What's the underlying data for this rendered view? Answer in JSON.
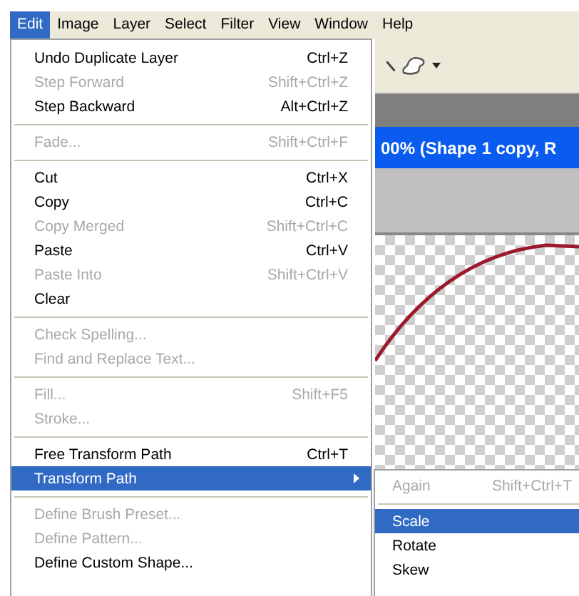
{
  "menu_bar": [
    {
      "label": "Edit",
      "selected": true
    },
    {
      "label": "Image",
      "selected": false
    },
    {
      "label": "Layer",
      "selected": false
    },
    {
      "label": "Select",
      "selected": false
    },
    {
      "label": "Filter",
      "selected": false
    },
    {
      "label": "View",
      "selected": false
    },
    {
      "label": "Window",
      "selected": false
    },
    {
      "label": "Help",
      "selected": false
    }
  ],
  "document": {
    "title": "00% (Shape 1 copy, R"
  },
  "edit_menu": [
    {
      "kind": "item",
      "label": "Undo Duplicate Layer",
      "shortcut": "Ctrl+Z",
      "disabled": false,
      "selected": false,
      "has_submenu": false
    },
    {
      "kind": "item",
      "label": "Step Forward",
      "shortcut": "Shift+Ctrl+Z",
      "disabled": true,
      "selected": false,
      "has_submenu": false
    },
    {
      "kind": "item",
      "label": "Step Backward",
      "shortcut": "Alt+Ctrl+Z",
      "disabled": false,
      "selected": false,
      "has_submenu": false
    },
    {
      "kind": "separator"
    },
    {
      "kind": "item",
      "label": "Fade...",
      "shortcut": "Shift+Ctrl+F",
      "disabled": true,
      "selected": false,
      "has_submenu": false
    },
    {
      "kind": "separator"
    },
    {
      "kind": "item",
      "label": "Cut",
      "shortcut": "Ctrl+X",
      "disabled": false,
      "selected": false,
      "has_submenu": false
    },
    {
      "kind": "item",
      "label": "Copy",
      "shortcut": "Ctrl+C",
      "disabled": false,
      "selected": false,
      "has_submenu": false
    },
    {
      "kind": "item",
      "label": "Copy Merged",
      "shortcut": "Shift+Ctrl+C",
      "disabled": true,
      "selected": false,
      "has_submenu": false
    },
    {
      "kind": "item",
      "label": "Paste",
      "shortcut": "Ctrl+V",
      "disabled": false,
      "selected": false,
      "has_submenu": false
    },
    {
      "kind": "item",
      "label": "Paste Into",
      "shortcut": "Shift+Ctrl+V",
      "disabled": true,
      "selected": false,
      "has_submenu": false
    },
    {
      "kind": "item",
      "label": "Clear",
      "disabled": false,
      "selected": false,
      "has_submenu": false
    },
    {
      "kind": "separator"
    },
    {
      "kind": "item",
      "label": "Check Spelling...",
      "disabled": true,
      "selected": false,
      "has_submenu": false
    },
    {
      "kind": "item",
      "label": "Find and Replace Text...",
      "disabled": true,
      "selected": false,
      "has_submenu": false
    },
    {
      "kind": "separator"
    },
    {
      "kind": "item",
      "label": "Fill...",
      "shortcut": "Shift+F5",
      "disabled": true,
      "selected": false,
      "has_submenu": false
    },
    {
      "kind": "item",
      "label": "Stroke...",
      "disabled": true,
      "selected": false,
      "has_submenu": false
    },
    {
      "kind": "separator"
    },
    {
      "kind": "item",
      "label": "Free Transform Path",
      "shortcut": "Ctrl+T",
      "disabled": false,
      "selected": false,
      "has_submenu": false
    },
    {
      "kind": "item",
      "label": "Transform Path",
      "disabled": false,
      "selected": true,
      "has_submenu": true
    },
    {
      "kind": "separator"
    },
    {
      "kind": "item",
      "label": "Define Brush Preset...",
      "disabled": true,
      "selected": false,
      "has_submenu": false
    },
    {
      "kind": "item",
      "label": "Define Pattern...",
      "disabled": true,
      "selected": false,
      "has_submenu": false
    },
    {
      "kind": "item",
      "label": "Define Custom Shape...",
      "disabled": false,
      "selected": false,
      "has_submenu": false
    }
  ],
  "submenu": [
    {
      "kind": "item",
      "label": "Again",
      "shortcut": "Shift+Ctrl+T",
      "disabled": true,
      "selected": false
    },
    {
      "kind": "separator"
    },
    {
      "kind": "item",
      "label": "Scale",
      "disabled": false,
      "selected": true
    },
    {
      "kind": "item",
      "label": "Rotate",
      "disabled": false,
      "selected": false
    },
    {
      "kind": "item",
      "label": "Skew",
      "disabled": false,
      "selected": false
    }
  ]
}
